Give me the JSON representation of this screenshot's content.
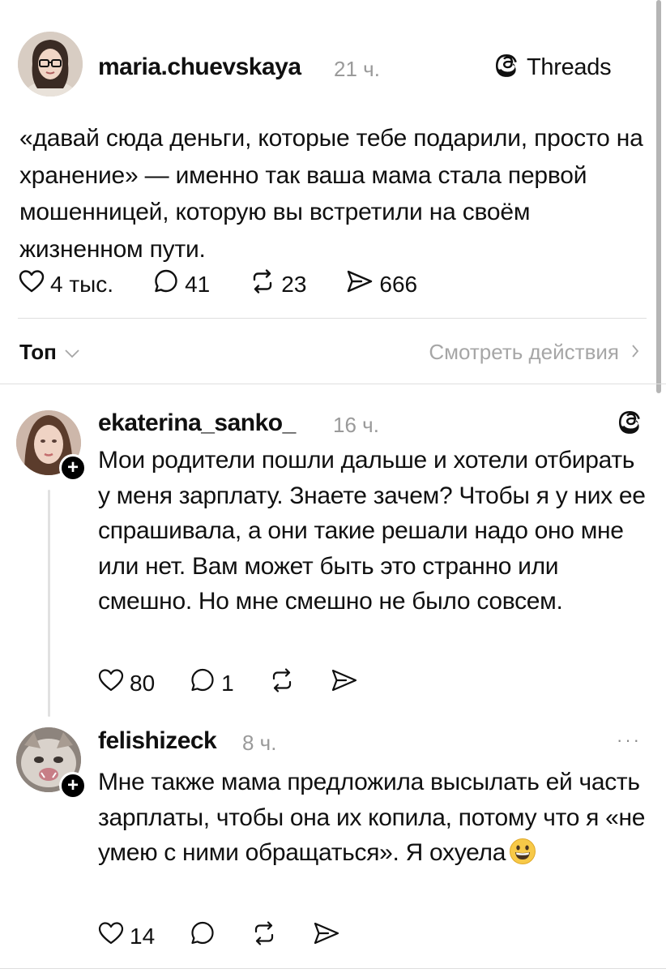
{
  "post": {
    "username": "maria.chuevskaya",
    "time": "21 ч.",
    "brand": "Threads",
    "text": "«давай сюда деньги, которые тебе подарили, просто на хранение» — именно так ваша мама стала первой мошенницей, которую вы встретили на своём жизненном пути.",
    "likes": "4 тыс.",
    "comments": "41",
    "reposts": "23",
    "shares": "666"
  },
  "sort": {
    "label": "Топ",
    "view_activity": "Смотреть действия"
  },
  "replies": [
    {
      "username": "ekaterina_sanko_",
      "time": "16 ч.",
      "text": "Мои родители пошли дальше и хотели отбирать у меня зарплату. Знаете зачем? Чтобы я у них ее спрашивала, а они такие решали надо оно мне или нет. Вам может быть это странно или смешно. Но мне смешно не было совсем.",
      "likes": "80",
      "comments": "1"
    },
    {
      "username": "felishizeck",
      "time": "8 ч.",
      "text": "Мне также мама предложила высылать ей часть зарплаты, чтобы она их копила, потому что я «не умею с ними обращаться». Я охуела",
      "likes": "14",
      "more": "···"
    }
  ],
  "icons": {
    "like": "heart-icon",
    "comment": "comment-bubble-icon",
    "repost": "repost-icon",
    "share": "send-icon",
    "threads": "threads-logo-icon",
    "follow": "plus-icon",
    "chevron": "chevron-icon"
  },
  "colors": {
    "text": "#101010",
    "muted": "#9a9a9a",
    "divider": "#dedede",
    "thread_line": "#e1e1e1"
  }
}
